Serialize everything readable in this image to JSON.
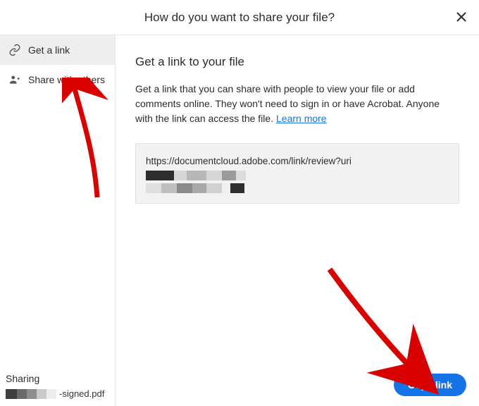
{
  "header": {
    "title": "How do you want to share your file?"
  },
  "sidebar": {
    "items": [
      {
        "label": "Get a link"
      },
      {
        "label": "Share with others"
      }
    ],
    "footer": {
      "sharing_label": "Sharing",
      "filename_suffix": "-signed.pdf"
    }
  },
  "main": {
    "title": "Get a link to your file",
    "description_part1": "Get a link that you can share with people to view your file or add comments online. They won't need to sign in or have Acrobat. Anyone with the link can access the file. ",
    "learn_more_label": "Learn more",
    "link_prefix": "https://documentcloud.adobe.com/link/review?uri",
    "copy_button_label": "Copy link"
  },
  "colors": {
    "accent": "#1473e6",
    "annotation": "#d90000"
  }
}
